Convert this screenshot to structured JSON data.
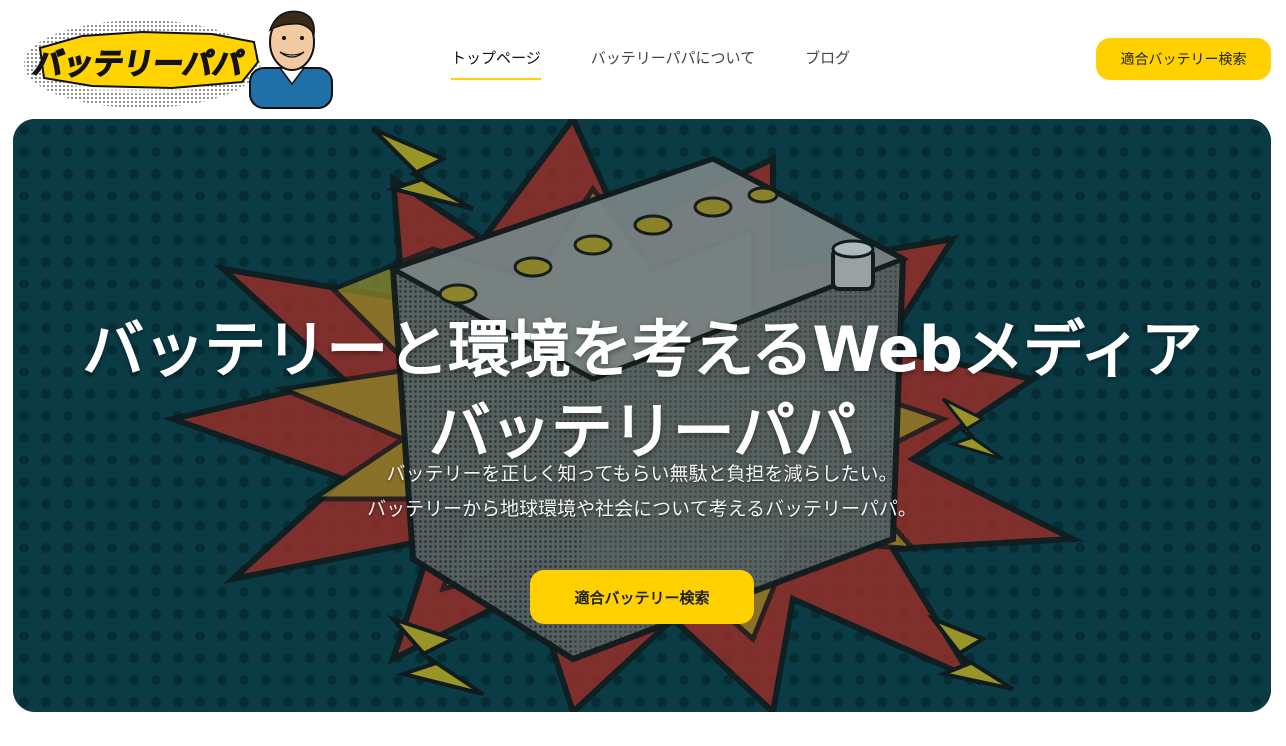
{
  "header": {
    "logo_text": "バッテリーパパ",
    "nav": [
      {
        "label": "トップページ",
        "active": true
      },
      {
        "label": "バッテリーパパについて",
        "active": false
      },
      {
        "label": "ブログ",
        "active": false
      }
    ],
    "cta_label": "適合バッテリー検索"
  },
  "hero": {
    "title_line1": "バッテリーと環境を考えるWebメディア",
    "title_line2": "バッテリーパパ",
    "subtitle_line1": "バッテリーを正しく知ってもらい無駄と負担を減らしたい。",
    "subtitle_line2": "バッテリーから地球環境や社会について考えるバッテリーパパ。",
    "cta_label": "適合バッテリー検索"
  },
  "colors": {
    "accent": "#ffd100",
    "hero_bg": "#0a3a44",
    "nav_underline": "#ffd400"
  },
  "icons": {
    "logo": "battery-papa-logo",
    "hero_illustration": "battery-explosion-illustration"
  }
}
